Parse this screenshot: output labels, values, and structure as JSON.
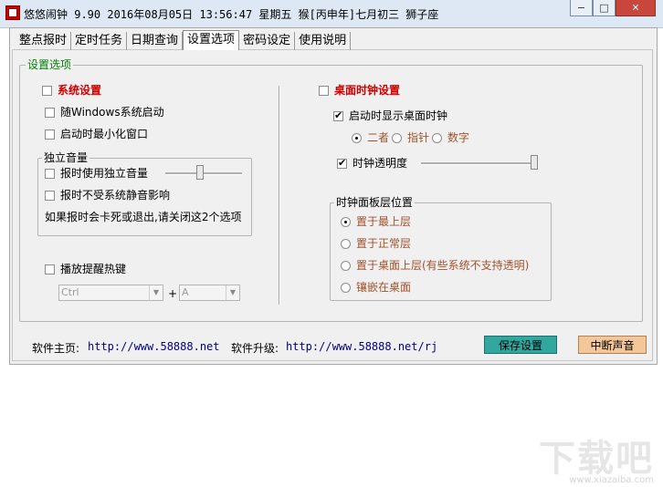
{
  "titlebar": {
    "title": "悠悠闹钟 9.90 2016年08月05日 13:56:47 星期五 猴[丙申年]七月初三 狮子座",
    "buttons": {
      "minimize": "−",
      "maximize": "□",
      "close": "✕"
    }
  },
  "tabs": [
    {
      "label": "整点报时"
    },
    {
      "label": "定时任务"
    },
    {
      "label": "日期查询"
    },
    {
      "label": "设置选项",
      "active": true
    },
    {
      "label": "密码设定"
    },
    {
      "label": "使用说明"
    }
  ],
  "settings": {
    "group_title": "设置选项",
    "left": {
      "system_settings": {
        "label": "系统设置",
        "checked": false
      },
      "windows_startup": {
        "label": "随Windows系统启动",
        "checked": false
      },
      "start_minimized": {
        "label": "启动时最小化窗口",
        "checked": false
      },
      "volume_group": {
        "title": "独立音量",
        "use_independent": {
          "label": "报时使用独立音量",
          "checked": false
        },
        "ignore_mute": {
          "label": "报时不受系统静音影响",
          "checked": false
        },
        "note": "如果报时会卡死或退出,请关闭这2个选项",
        "volume_level": 0.45
      },
      "hotkey": {
        "label": "播放提醒热键",
        "checked": false,
        "modifier": "Ctrl",
        "plus": "+",
        "key": "A"
      }
    },
    "right": {
      "desktop_clock": {
        "label": "桌面时钟设置",
        "checked": false
      },
      "show_on_start": {
        "label": "启动时显示桌面时钟",
        "checked": true
      },
      "display_mode": {
        "options": [
          "二者",
          "指针",
          "数字"
        ],
        "selected": "二者"
      },
      "transparency": {
        "label": "时钟透明度",
        "checked": true,
        "level": 1.0
      },
      "layer_group": {
        "title": "时钟面板层位置",
        "options": [
          "置于最上层",
          "置于正常层",
          "置于桌面上层(有些系统不支持透明)",
          "镶嵌在桌面"
        ],
        "selected": "置于最上层"
      }
    }
  },
  "footer": {
    "homepage_label": "软件主页:",
    "homepage_url": "http://www.58888.net",
    "upgrade_label": "软件升级:",
    "upgrade_url": "http://www.58888.net/rj",
    "save_button": "保存设置",
    "stop_sound_button": "中断声音"
  },
  "watermark": {
    "text": "下载吧",
    "url": "www.xiazaiba.com"
  }
}
